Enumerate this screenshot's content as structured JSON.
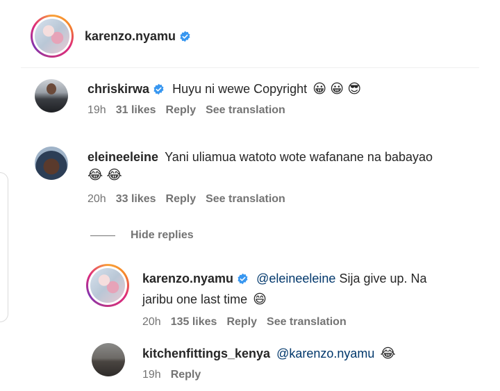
{
  "post_author": {
    "username": "karenzo.nyamu"
  },
  "comments": [
    {
      "username": "chriskirwa",
      "text": "Huyu ni wewe Copyright",
      "emojis": "😀 😀 😎",
      "time": "19h",
      "likes": "31 likes",
      "reply": "Reply",
      "translate": "See translation"
    },
    {
      "username": "eleineeleine",
      "text": "Yani uliamua watoto wote wafanane na babayao",
      "emojis": "😂 😂",
      "time": "20h",
      "likes": "33 likes",
      "reply": "Reply",
      "translate": "See translation"
    }
  ],
  "hide_replies_label": "Hide replies",
  "replies": [
    {
      "username": "karenzo.nyamu",
      "mention": "@eleineeleine",
      "text_line1": "Sija give up. Na",
      "text_line2": "jaribu one last time",
      "emojis": "😄",
      "time": "20h",
      "likes": "135 likes",
      "reply": "Reply",
      "translate": "See translation"
    },
    {
      "username": "kitchenfittings_kenya",
      "mention": "@karenzo.nyamu",
      "emojis": "😂",
      "time": "19h",
      "reply": "Reply"
    }
  ],
  "colors": {
    "verified": "#3897f0",
    "mention": "#00376b",
    "meta": "#737373"
  }
}
